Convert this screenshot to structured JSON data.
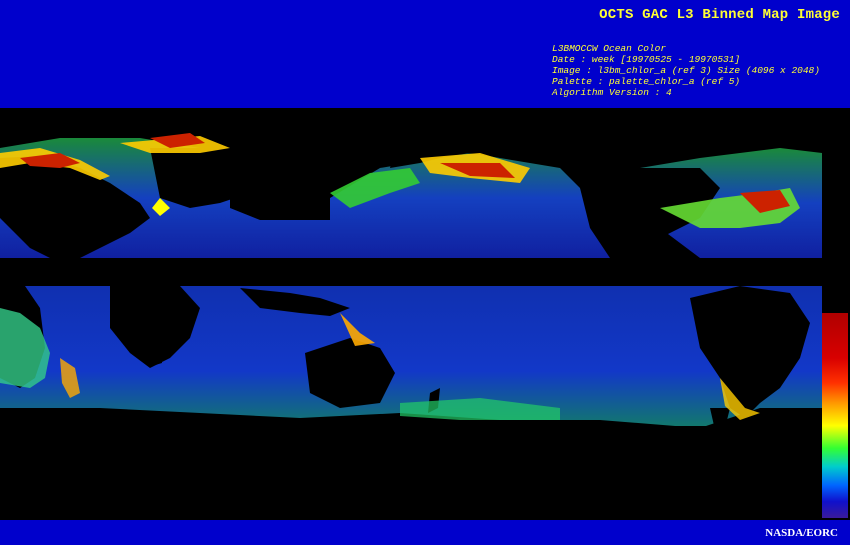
{
  "header": {
    "title": "OCTS GAC L3 Binned Map Image",
    "meta_lines": [
      "L3BMOCCW Ocean Color",
      "Date : week [19970525 - 19970531]",
      "Image : l3bm_chlor_a (ref 3) Size (4096 x 2048)",
      "Palette : palette_chlor_a (ref 5)",
      "Algorithm Version : 4"
    ]
  },
  "footer": {
    "credit": "NASDA/EORC"
  },
  "colors": {
    "header_bg": "#0000cc",
    "title_color": "#ffff33",
    "land_and_nodata": "#000000",
    "colorbar": [
      "#b00000",
      "#ff3000",
      "#ff9900",
      "#ffff00",
      "#33ff33",
      "#00cccc",
      "#0066ff",
      "#3a1a9a"
    ]
  }
}
